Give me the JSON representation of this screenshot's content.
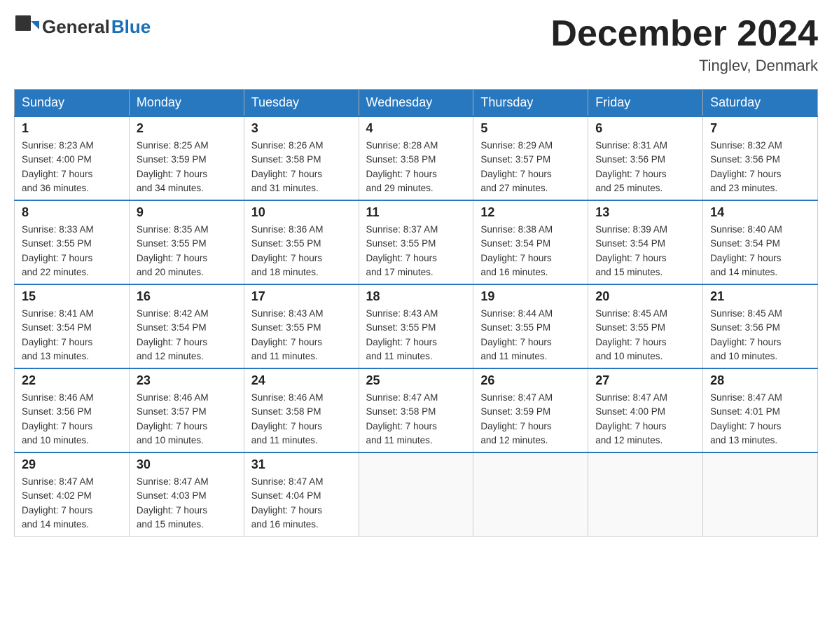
{
  "header": {
    "logo": {
      "general": "General",
      "blue": "Blue"
    },
    "title": "December 2024",
    "location": "Tinglev, Denmark"
  },
  "calendar": {
    "days_of_week": [
      "Sunday",
      "Monday",
      "Tuesday",
      "Wednesday",
      "Thursday",
      "Friday",
      "Saturday"
    ],
    "weeks": [
      [
        {
          "day": "1",
          "sunrise": "8:23 AM",
          "sunset": "4:00 PM",
          "daylight": "7 hours and 36 minutes."
        },
        {
          "day": "2",
          "sunrise": "8:25 AM",
          "sunset": "3:59 PM",
          "daylight": "7 hours and 34 minutes."
        },
        {
          "day": "3",
          "sunrise": "8:26 AM",
          "sunset": "3:58 PM",
          "daylight": "7 hours and 31 minutes."
        },
        {
          "day": "4",
          "sunrise": "8:28 AM",
          "sunset": "3:58 PM",
          "daylight": "7 hours and 29 minutes."
        },
        {
          "day": "5",
          "sunrise": "8:29 AM",
          "sunset": "3:57 PM",
          "daylight": "7 hours and 27 minutes."
        },
        {
          "day": "6",
          "sunrise": "8:31 AM",
          "sunset": "3:56 PM",
          "daylight": "7 hours and 25 minutes."
        },
        {
          "day": "7",
          "sunrise": "8:32 AM",
          "sunset": "3:56 PM",
          "daylight": "7 hours and 23 minutes."
        }
      ],
      [
        {
          "day": "8",
          "sunrise": "8:33 AM",
          "sunset": "3:55 PM",
          "daylight": "7 hours and 22 minutes."
        },
        {
          "day": "9",
          "sunrise": "8:35 AM",
          "sunset": "3:55 PM",
          "daylight": "7 hours and 20 minutes."
        },
        {
          "day": "10",
          "sunrise": "8:36 AM",
          "sunset": "3:55 PM",
          "daylight": "7 hours and 18 minutes."
        },
        {
          "day": "11",
          "sunrise": "8:37 AM",
          "sunset": "3:55 PM",
          "daylight": "7 hours and 17 minutes."
        },
        {
          "day": "12",
          "sunrise": "8:38 AM",
          "sunset": "3:54 PM",
          "daylight": "7 hours and 16 minutes."
        },
        {
          "day": "13",
          "sunrise": "8:39 AM",
          "sunset": "3:54 PM",
          "daylight": "7 hours and 15 minutes."
        },
        {
          "day": "14",
          "sunrise": "8:40 AM",
          "sunset": "3:54 PM",
          "daylight": "7 hours and 14 minutes."
        }
      ],
      [
        {
          "day": "15",
          "sunrise": "8:41 AM",
          "sunset": "3:54 PM",
          "daylight": "7 hours and 13 minutes."
        },
        {
          "day": "16",
          "sunrise": "8:42 AM",
          "sunset": "3:54 PM",
          "daylight": "7 hours and 12 minutes."
        },
        {
          "day": "17",
          "sunrise": "8:43 AM",
          "sunset": "3:55 PM",
          "daylight": "7 hours and 11 minutes."
        },
        {
          "day": "18",
          "sunrise": "8:43 AM",
          "sunset": "3:55 PM",
          "daylight": "7 hours and 11 minutes."
        },
        {
          "day": "19",
          "sunrise": "8:44 AM",
          "sunset": "3:55 PM",
          "daylight": "7 hours and 11 minutes."
        },
        {
          "day": "20",
          "sunrise": "8:45 AM",
          "sunset": "3:55 PM",
          "daylight": "7 hours and 10 minutes."
        },
        {
          "day": "21",
          "sunrise": "8:45 AM",
          "sunset": "3:56 PM",
          "daylight": "7 hours and 10 minutes."
        }
      ],
      [
        {
          "day": "22",
          "sunrise": "8:46 AM",
          "sunset": "3:56 PM",
          "daylight": "7 hours and 10 minutes."
        },
        {
          "day": "23",
          "sunrise": "8:46 AM",
          "sunset": "3:57 PM",
          "daylight": "7 hours and 10 minutes."
        },
        {
          "day": "24",
          "sunrise": "8:46 AM",
          "sunset": "3:58 PM",
          "daylight": "7 hours and 11 minutes."
        },
        {
          "day": "25",
          "sunrise": "8:47 AM",
          "sunset": "3:58 PM",
          "daylight": "7 hours and 11 minutes."
        },
        {
          "day": "26",
          "sunrise": "8:47 AM",
          "sunset": "3:59 PM",
          "daylight": "7 hours and 12 minutes."
        },
        {
          "day": "27",
          "sunrise": "8:47 AM",
          "sunset": "4:00 PM",
          "daylight": "7 hours and 12 minutes."
        },
        {
          "day": "28",
          "sunrise": "8:47 AM",
          "sunset": "4:01 PM",
          "daylight": "7 hours and 13 minutes."
        }
      ],
      [
        {
          "day": "29",
          "sunrise": "8:47 AM",
          "sunset": "4:02 PM",
          "daylight": "7 hours and 14 minutes."
        },
        {
          "day": "30",
          "sunrise": "8:47 AM",
          "sunset": "4:03 PM",
          "daylight": "7 hours and 15 minutes."
        },
        {
          "day": "31",
          "sunrise": "8:47 AM",
          "sunset": "4:04 PM",
          "daylight": "7 hours and 16 minutes."
        },
        null,
        null,
        null,
        null
      ]
    ]
  }
}
